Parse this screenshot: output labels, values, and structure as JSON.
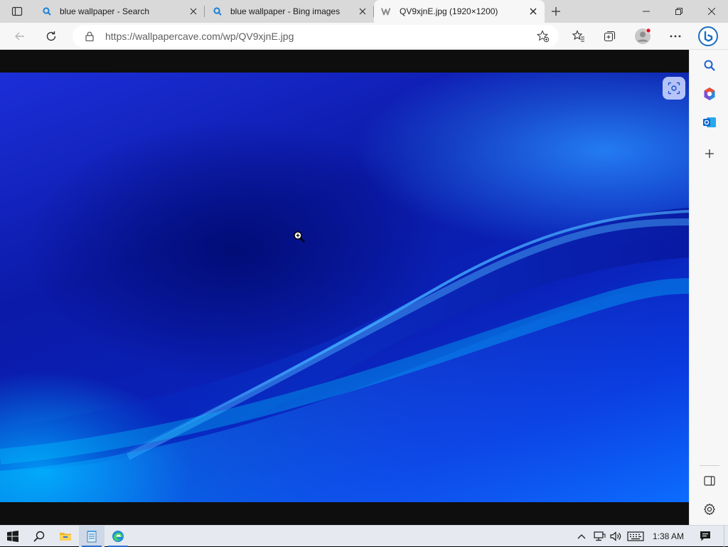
{
  "browser": {
    "tabs": [
      {
        "title": "blue wallpaper - Search",
        "favicon": "bing-search-icon",
        "active": false
      },
      {
        "title": "blue wallpaper - Bing images",
        "favicon": "bing-search-icon",
        "active": false
      },
      {
        "title": "QV9xjnE.jpg (1920×1200)",
        "favicon": "wallpapercave-icon",
        "active": true
      }
    ],
    "address_bar": {
      "url": "https://wallpapercave.com/wp/QV9xjnE.jpg"
    },
    "colors": {
      "tabstrip": "#d9d9d9",
      "toolbar": "#f7f7f7",
      "accent": "#0078d4"
    }
  },
  "taskbar": {
    "clock": "1:38 AM",
    "apps": [
      "windows-start",
      "search",
      "file-explorer",
      "notepad",
      "microsoft-edge"
    ]
  }
}
